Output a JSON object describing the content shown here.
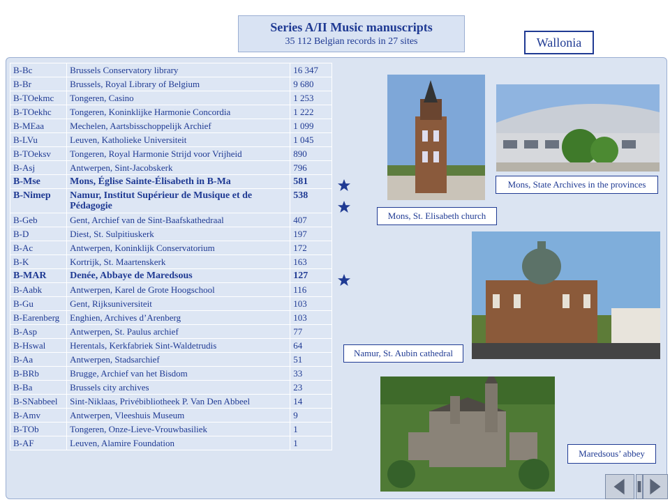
{
  "header": {
    "title": "Series A/II Music manuscripts",
    "subtitle": "35 112 Belgian records in 27 sites",
    "region": "Wallonia"
  },
  "table": {
    "rows": [
      {
        "code": "B-Bc",
        "name": "Brussels Conservatory library",
        "count": "16 347",
        "bold": false
      },
      {
        "code": "B-Br",
        "name": "Brussels, Royal Library of Belgium",
        "count": "9 680",
        "bold": false
      },
      {
        "code": "B-TOekmc",
        "name": "Tongeren, Casino",
        "count": "1 253",
        "bold": false
      },
      {
        "code": "B-TOekhc",
        "name": "Tongeren, Koninklijke Harmonie Concordia",
        "count": "1 222",
        "bold": false
      },
      {
        "code": "B-MEaa",
        "name": "Mechelen, Aartsbisschoppelijk Archief",
        "count": "1 099",
        "bold": false
      },
      {
        "code": "B-LVu",
        "name": "Leuven, Katholieke Universiteit",
        "count": "1 045",
        "bold": false
      },
      {
        "code": "B-TOeksv",
        "name": "Tongeren, Royal Harmonie Strijd voor Vrijheid",
        "count": "890",
        "bold": false
      },
      {
        "code": "B-Asj",
        "name": "Antwerpen, Sint-Jacobskerk",
        "count": "796",
        "bold": false
      },
      {
        "code": "B-Mse",
        "name": "Mons, Église Sainte-Élisabeth in B-Ma",
        "count": "581",
        "bold": true
      },
      {
        "code": "B-Nimep",
        "name": "Namur, Institut Supérieur de Musique et de Pédagogie",
        "count": "538",
        "bold": true
      },
      {
        "code": "B-Geb",
        "name": "Gent, Archief van de Sint-Baafskathedraal",
        "count": "407",
        "bold": false
      },
      {
        "code": "B-D",
        "name": "Diest, St. Sulpitiuskerk",
        "count": "197",
        "bold": false
      },
      {
        "code": "B-Ac",
        "name": "Antwerpen, Koninklijk Conservatorium",
        "count": "172",
        "bold": false
      },
      {
        "code": "B-K",
        "name": "Kortrijk, St. Maartenskerk",
        "count": "163",
        "bold": false
      },
      {
        "code": "B-MAR",
        "name": "Denée, Abbaye de Maredsous",
        "count": "127",
        "bold": true
      },
      {
        "code": "B-Aabk",
        "name": "Antwerpen, Karel de Grote Hoogschool",
        "count": "116",
        "bold": false
      },
      {
        "code": "B-Gu",
        "name": "Gent, Rijksuniversiteit",
        "count": "103",
        "bold": false
      },
      {
        "code": "B-Earenberg",
        "name": "Enghien, Archives d’Arenberg",
        "count": "103",
        "bold": false
      },
      {
        "code": "B-Asp",
        "name": "Antwerpen, St. Paulus archief",
        "count": "77",
        "bold": false
      },
      {
        "code": "B-Hswal",
        "name": "Herentals, Kerkfabriek Sint-Waldetrudis",
        "count": "64",
        "bold": false
      },
      {
        "code": "B-Aa",
        "name": "Antwerpen, Stadsarchief",
        "count": "51",
        "bold": false
      },
      {
        "code": "B-BRb",
        "name": "Brugge, Archief van het Bisdom",
        "count": "33",
        "bold": false
      },
      {
        "code": "B-Ba",
        "name": "Brussels city archives",
        "count": "23",
        "bold": false
      },
      {
        "code": "B-SNabbeel",
        "name": "Sint-Niklaas, Privébibliotheek P. Van Den Abbeel",
        "count": "14",
        "bold": false
      },
      {
        "code": "B-Amv",
        "name": "Antwerpen, Vleeshuis Museum",
        "count": "9",
        "bold": false
      },
      {
        "code": "B-TOb",
        "name": "Tongeren, Onze-Lieve-Vrouwbasiliek",
        "count": "1",
        "bold": false
      },
      {
        "code": "B-AF",
        "name": "Leuven, Alamire Foundation",
        "count": "1",
        "bold": false
      }
    ]
  },
  "captions": {
    "mons_church": "Mons, St. Elisabeth church",
    "mons_archives": "Mons, State Archives in the provinces",
    "namur": "Namur, St. Aubin cathedral",
    "maredsous": "Maredsous’ abbey"
  },
  "icons": {
    "star": "star-icon",
    "prev": "arrow-left-icon",
    "stop": "stop-icon",
    "next": "arrow-right-icon"
  },
  "colors": {
    "accent": "#1f3a93",
    "panel": "#dbe4f2",
    "star": "#1f3a93"
  }
}
